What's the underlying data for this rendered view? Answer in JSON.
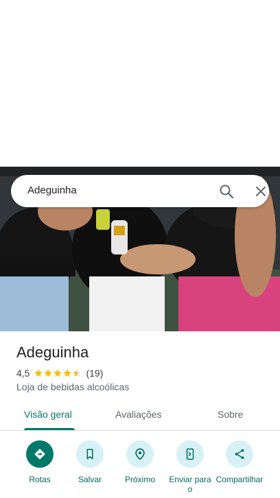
{
  "search": {
    "query": "Adeguinha"
  },
  "place": {
    "name": "Adeguinha",
    "rating": "4,5",
    "rating_value": 4.5,
    "reviews_count": "(19)",
    "category": "Loja de bebidas alcoólicas"
  },
  "tabs": [
    {
      "label": "Visão geral",
      "active": true
    },
    {
      "label": "Avaliações",
      "active": false
    },
    {
      "label": "Sobre",
      "active": false
    }
  ],
  "actions": [
    {
      "label": "Rotas",
      "icon": "directions-icon"
    },
    {
      "label": "Salvar",
      "icon": "bookmark-icon"
    },
    {
      "label": "Próximo",
      "icon": "nearby-icon"
    },
    {
      "label": "Enviar para o",
      "icon": "send-to-phone-icon"
    },
    {
      "label": "Compartilhar",
      "icon": "share-icon"
    }
  ],
  "colors": {
    "accent": "#00796b",
    "star": "#fbbc04",
    "action_bg": "#d7f1f6"
  }
}
